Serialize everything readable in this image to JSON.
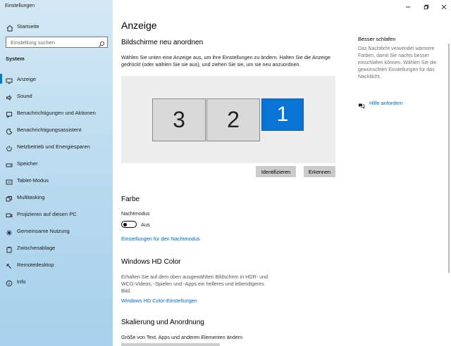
{
  "window": {
    "title": "Einstellungen"
  },
  "sidebar": {
    "home_label": "Startseite",
    "search_placeholder": "Einstellung suchen",
    "section": "System",
    "items": [
      {
        "label": "Anzeige",
        "icon": "monitor-icon",
        "active": true
      },
      {
        "label": "Sound",
        "icon": "speaker-icon"
      },
      {
        "label": "Benachrichtigungen und Aktionen",
        "icon": "notification-icon"
      },
      {
        "label": "Benachrichtigungsassistent",
        "icon": "moon-icon"
      },
      {
        "label": "Netzbetrieb und Energiesparen",
        "icon": "power-icon"
      },
      {
        "label": "Speicher",
        "icon": "storage-icon"
      },
      {
        "label": "Tablet-Modus",
        "icon": "tablet-icon"
      },
      {
        "label": "Multitasking",
        "icon": "multitasking-icon"
      },
      {
        "label": "Projizieren auf diesen PC",
        "icon": "project-icon"
      },
      {
        "label": "Gemeinsame Nutzung",
        "icon": "share-icon"
      },
      {
        "label": "Zwischenablage",
        "icon": "clipboard-icon"
      },
      {
        "label": "Remotedesktop",
        "icon": "remote-icon"
      },
      {
        "label": "Info",
        "icon": "info-icon"
      }
    ]
  },
  "main": {
    "title": "Anzeige",
    "arrange": {
      "heading": "Bildschirme neu anordnen",
      "desc_line1": "Wählen Sie unten eine Anzeige aus, um ihre Einstellungen zu ändern. Halten Sie die Anzeige",
      "desc_line2": "gedrückt (oder wählen Sie sie aus), und ziehen Sie sie, um sie neu anzuordnen.",
      "monitors": [
        "3",
        "2",
        "1"
      ],
      "selected_monitor": "1",
      "identify_label": "Identifizieren",
      "detect_label": "Erkennen"
    },
    "color": {
      "heading": "Farbe",
      "night_mode_label": "Nachtmodus",
      "toggle_state": "Aus",
      "toggle_on": false,
      "settings_link": "Einstellungen für den Nachtmodus"
    },
    "hdr": {
      "heading": "Windows HD Color",
      "desc_line1": "Erhalten Sie auf dem oben ausgewählten Bildschirm in HDR- und",
      "desc_line2": "WCG-Videos, -Spielen und -Apps ein helleres und lebendigeres",
      "desc_line3": "Bild.",
      "link": "Windows HD Color-Einstellungen"
    },
    "scale": {
      "heading": "Skalierung und Anordnung",
      "subheading": "Größe von Text, Apps und anderen Elementen ändern"
    }
  },
  "aside": {
    "heading": "Besser schlafen",
    "line1": "Das Nachtlicht verwendet wärmere",
    "line2": "Farben, damit Sie nachts besser",
    "line3": "einschlafen können. Wählen Sie die",
    "line4": "gewünschten Einstellungen für das",
    "line5": "Nachtlicht.",
    "help_link": "Hilfe anfordern"
  },
  "colors": {
    "accent": "#0078d7",
    "link": "#0067c0",
    "selected_monitor": "#0a74d4"
  }
}
